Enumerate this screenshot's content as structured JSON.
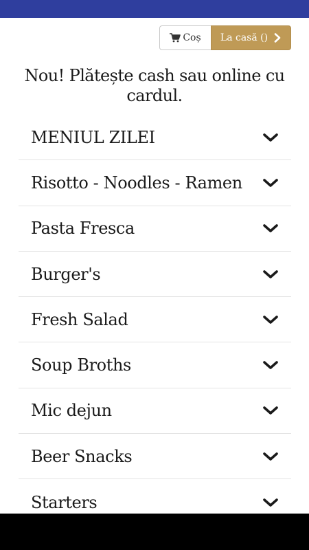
{
  "header": {
    "cart_label": "Coș",
    "checkout_label": "La casă ()",
    "accent_color": "#bf9a56",
    "status_bar_color": "#2f3e9e"
  },
  "announcement": "Nou! Plătește cash sau online cu cardul.",
  "menu": {
    "items": [
      {
        "label": "MENIUL ZILEI"
      },
      {
        "label": "Risotto - Noodles - Ramen"
      },
      {
        "label": "Pasta Fresca"
      },
      {
        "label": "Burger's"
      },
      {
        "label": "Fresh Salad"
      },
      {
        "label": "Soup Broths"
      },
      {
        "label": "Mic dejun"
      },
      {
        "label": "Beer Snacks"
      },
      {
        "label": "Starters"
      }
    ]
  }
}
